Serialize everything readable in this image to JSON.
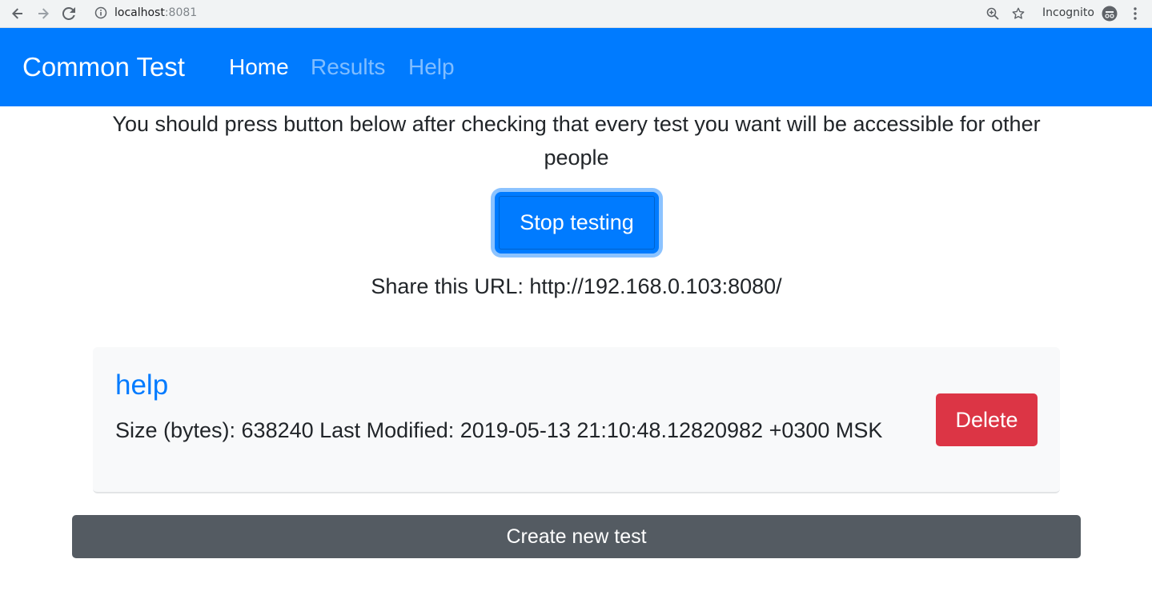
{
  "browser": {
    "url_host": "localhost",
    "url_port": ":8081",
    "incognito_label": "Incognito"
  },
  "navbar": {
    "brand": "Common Test",
    "links": [
      {
        "label": "Home",
        "active": true
      },
      {
        "label": "Results",
        "active": false
      },
      {
        "label": "Help",
        "active": false
      }
    ]
  },
  "main": {
    "intro_text": "You should press button below after checking that every test you want will be accessible for other people",
    "stop_button_label": "Stop testing",
    "share_url_text": "Share this URL: http://192.168.0.103:8080/",
    "tests": [
      {
        "name": "help",
        "meta": "Size (bytes): 638240 Last Modified: 2019-05-13 21:10:48.12820982 +0300 MSK",
        "delete_label": "Delete"
      }
    ],
    "create_button_label": "Create new test"
  },
  "colors": {
    "primary": "#007bff",
    "danger": "#dc3545",
    "secondary": "#545b62",
    "card_bg": "#f8f9fa"
  }
}
